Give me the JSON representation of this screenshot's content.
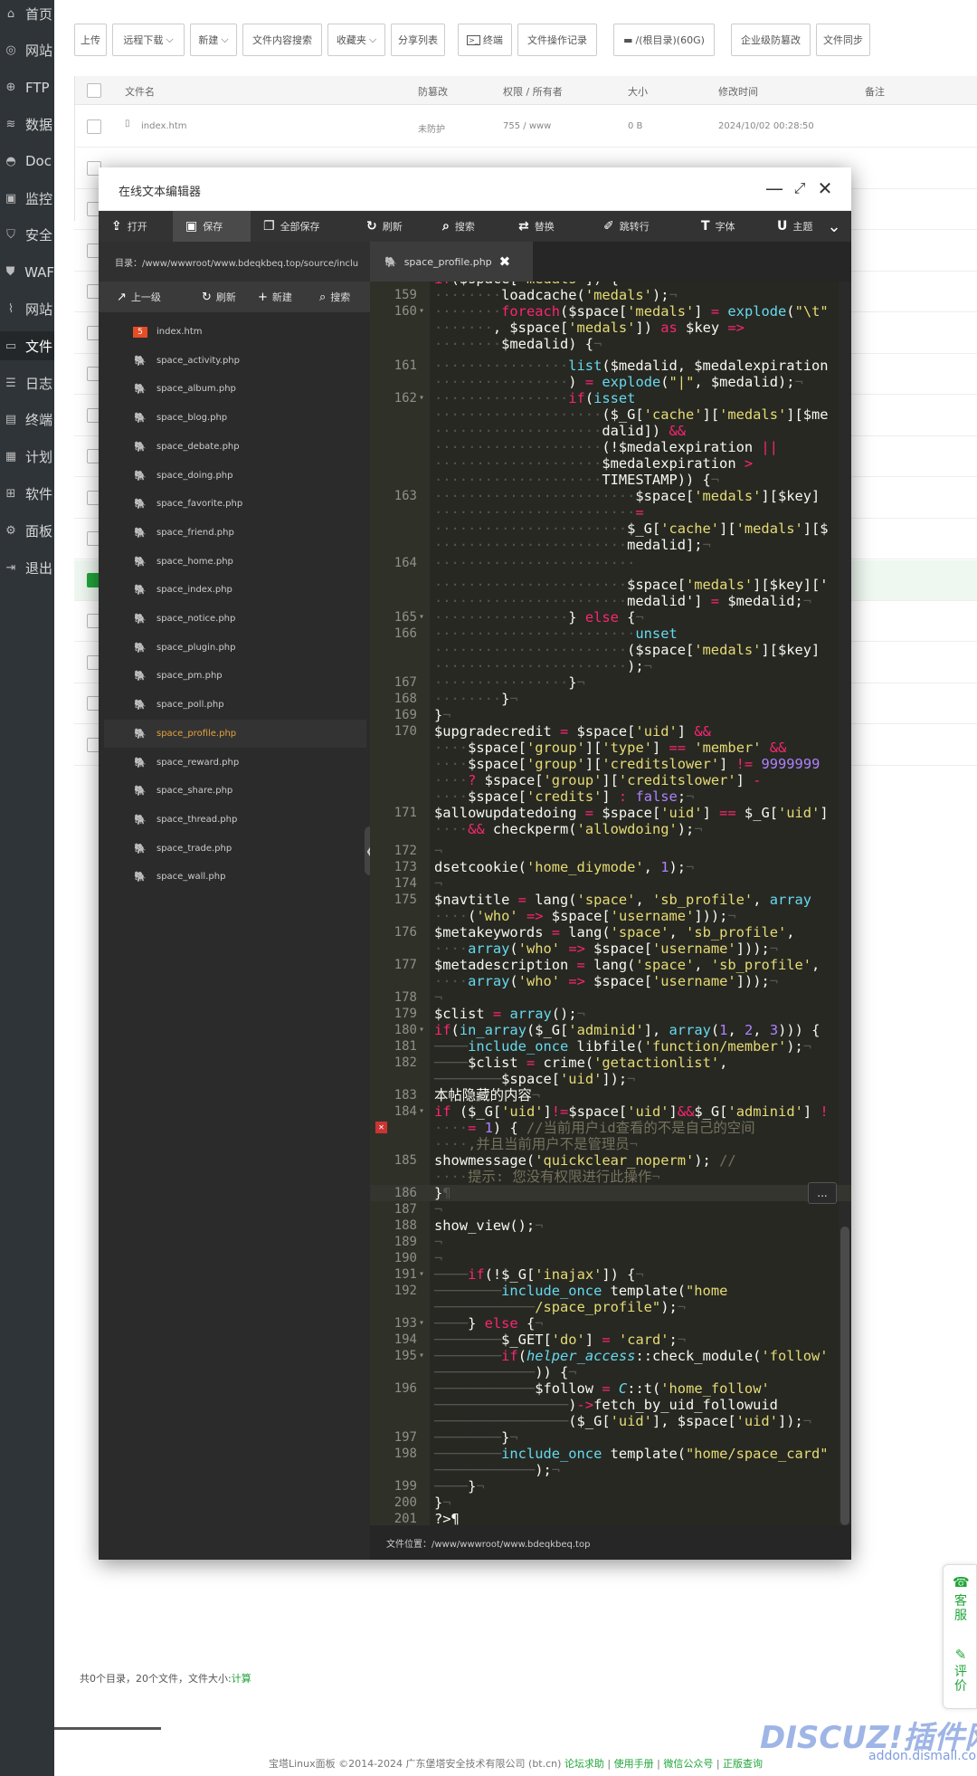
{
  "sidebar": {
    "items": [
      {
        "label": "首页",
        "icon": "home-icon"
      },
      {
        "label": "网站",
        "icon": "globe-icon"
      },
      {
        "label": "FTP",
        "icon": "ftp-icon"
      },
      {
        "label": "数据",
        "icon": "database-icon"
      },
      {
        "label": "Doc",
        "icon": "docker-icon"
      },
      {
        "label": "监控",
        "icon": "monitor-icon"
      },
      {
        "label": "安全",
        "icon": "shield-icon"
      },
      {
        "label": "WAF",
        "icon": "waf-icon"
      },
      {
        "label": "网站",
        "icon": "chart-icon"
      },
      {
        "label": "文件",
        "icon": "folder-icon",
        "active": true
      },
      {
        "label": "日志",
        "icon": "log-icon"
      },
      {
        "label": "终端",
        "icon": "terminal-icon"
      },
      {
        "label": "计划",
        "icon": "calendar-icon"
      },
      {
        "label": "软件",
        "icon": "apps-icon"
      },
      {
        "label": "面板",
        "icon": "gear-icon"
      },
      {
        "label": "退出",
        "icon": "logout-icon"
      }
    ]
  },
  "toolbar": {
    "upload": "上传",
    "remote_download": "远程下载",
    "new": "新建",
    "content_search": "文件内容搜索",
    "favorites": "收藏夹",
    "share_list": "分享列表",
    "terminal": "终端",
    "operation_log": "文件操作记录",
    "disk": "/(根目录)(60G)",
    "tamper_proof": "企业级防篡改",
    "sync": "文件同步"
  },
  "file_table": {
    "headers": [
      "文件名",
      "防篡改",
      "权限 / 所有者",
      "大小",
      "修改时间",
      "备注"
    ],
    "first_row": {
      "name": "index.htm",
      "tamper": "未防护",
      "perm": "755 / www",
      "size": "0 B",
      "mtime": "2024/10/02 00:28:50"
    }
  },
  "summary": {
    "text": "共0个目录，20个文件，文件大小:",
    "link": "计算"
  },
  "footer": {
    "copyright": "宝塔Linux面板 ©2014-2024 广东堡塔安全技术有限公司 (bt.cn)",
    "links": [
      "论坛求助",
      "使用手册",
      "微信公众号",
      "正版查询"
    ]
  },
  "feedback": {
    "service": "客服",
    "review": "评价"
  },
  "watermark": {
    "logo": "DISCUZ!插件网",
    "url": "addon.dismall.com"
  },
  "editor": {
    "title": "在线文本编辑器",
    "toolbar": [
      {
        "label": "打开",
        "icon": "upload-icon"
      },
      {
        "label": "保存",
        "icon": "save-icon"
      },
      {
        "label": "全部保存",
        "icon": "save-all-icon"
      },
      {
        "label": "刷新",
        "icon": "refresh-icon"
      },
      {
        "label": "搜索",
        "icon": "search-icon"
      },
      {
        "label": "替换",
        "icon": "replace-icon"
      },
      {
        "label": "跳转行",
        "icon": "pin-icon"
      },
      {
        "label": "字体",
        "icon": "font-icon"
      },
      {
        "label": "主题",
        "icon": "magnet-icon"
      }
    ],
    "directory": "目录：/www/wwwroot/www.bdeqkbeq.top/source/inclu",
    "dir_actions": {
      "up": "上一级",
      "refresh": "刷新",
      "new": "新建",
      "search": "搜索"
    },
    "files": [
      "index.htm",
      "space_activity.php",
      "space_album.php",
      "space_blog.php",
      "space_debate.php",
      "space_doing.php",
      "space_favorite.php",
      "space_friend.php",
      "space_home.php",
      "space_index.php",
      "space_notice.php",
      "space_plugin.php",
      "space_pm.php",
      "space_poll.php",
      "space_profile.php",
      "space_reward.php",
      "space_share.php",
      "space_thread.php",
      "space_trade.php",
      "space_wall.php"
    ],
    "active_file": "space_profile.php",
    "tab": "space_profile.php",
    "status": "文件位置：/www/wwwroot/www.bdeqkbeq.top"
  }
}
